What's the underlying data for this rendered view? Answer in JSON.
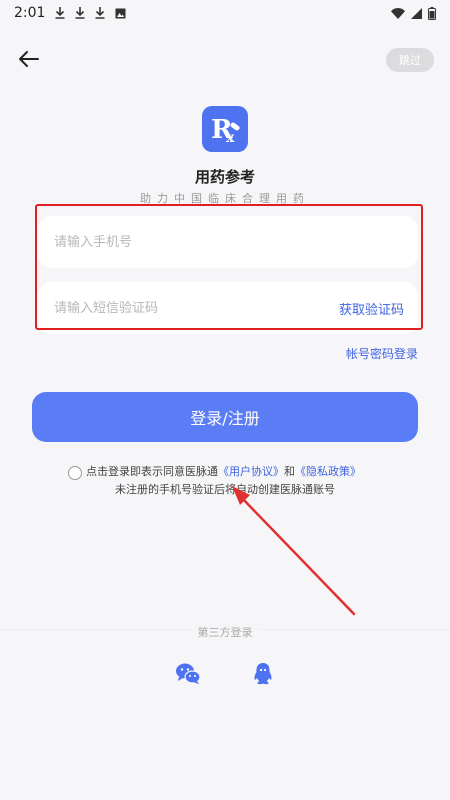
{
  "status_bar": {
    "time": "2:01",
    "icons": [
      "download-icon",
      "download-icon",
      "download-icon",
      "photo-icon",
      "wifi-icon",
      "signal-icon",
      "battery-icon"
    ]
  },
  "nav": {
    "back_icon": "arrow-left-icon",
    "skip_label": "跳过"
  },
  "app": {
    "logo_text": "Rx",
    "title": "用药参考",
    "subtitle": "助力中国临床合理用药"
  },
  "form": {
    "phone_placeholder": "请输入手机号",
    "code_placeholder": "请输入短信验证码",
    "get_code_label": "获取验证码",
    "password_login_label": "帐号密码登录",
    "submit_label": "登录/注册"
  },
  "agreement": {
    "prefix": "点击登录即表示同意医脉通",
    "user_agreement": "《用户协议》",
    "and": "和",
    "privacy_policy": "《隐私政策》",
    "note": "未注册的手机号验证后将自动创建医脉通账号"
  },
  "third_party": {
    "label": "第三方登录",
    "options": [
      "wechat-icon",
      "qq-icon"
    ]
  },
  "colors": {
    "accent": "#5a7cf4",
    "link": "#3f63e0",
    "highlight": "#e02020",
    "background": "#f6f6f8"
  }
}
